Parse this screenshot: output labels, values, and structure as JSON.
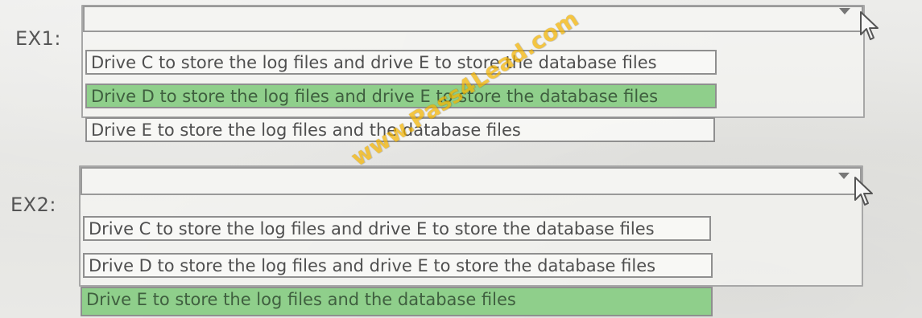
{
  "sections": [
    {
      "label": "EX1:",
      "options": [
        "Drive C to store the log files and drive E to store the database files",
        "Drive D to store the log files and drive E to store the database files",
        "Drive E to store the log files and the database files"
      ],
      "selected_index": 1
    },
    {
      "label": "EX2:",
      "options": [
        "Drive C to store the log files and drive E to store the database files",
        "Drive D to store the log files and drive E to store the database files",
        "Drive E to store the log files and the database files"
      ],
      "selected_index": 2
    }
  ],
  "watermark": "www.Pass4Lead.com",
  "icons": {
    "dropdown": "chevron-down-icon",
    "cursor": "mouse-pointer-icon"
  },
  "colors": {
    "selected_option": "#8fcf8b",
    "watermark": "#f4b400"
  }
}
